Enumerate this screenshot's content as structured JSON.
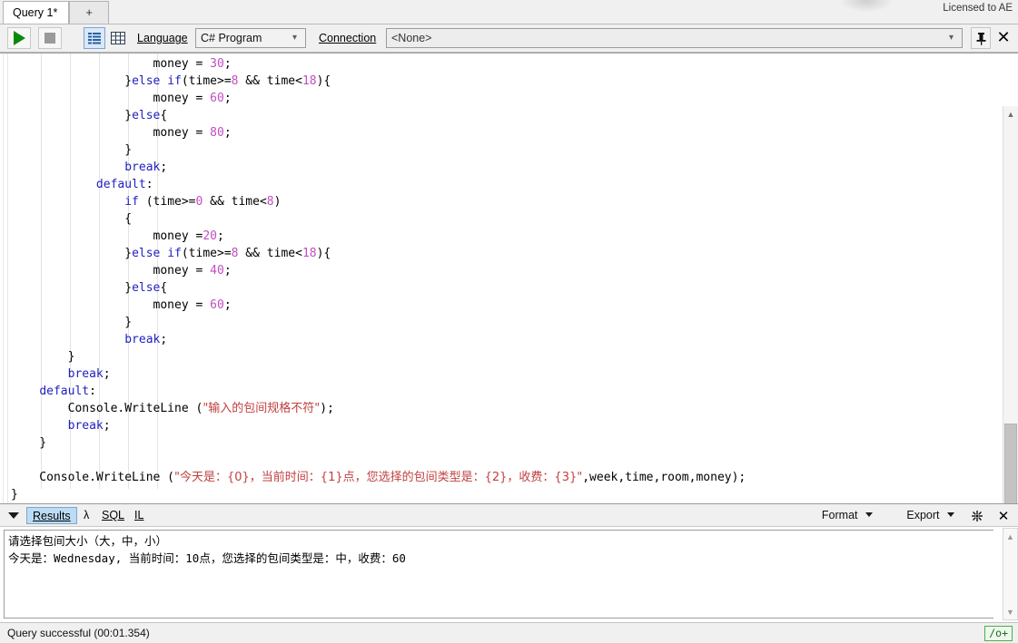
{
  "window": {
    "license": "Licensed to AE"
  },
  "tabs": {
    "items": [
      {
        "label": "Query 1*",
        "active": true
      },
      {
        "label": "+",
        "active": false
      }
    ]
  },
  "toolbar": {
    "run_icon": "play-icon",
    "stop_icon": "stop-icon",
    "output_text_icon": "text-output-icon",
    "output_grid_icon": "grid-output-icon",
    "language_label": "Language",
    "language_value": "C# Program",
    "connection_label": "Connection",
    "connection_value": "<None>",
    "pin_icon": "pin-icon",
    "close_icon": "close-icon"
  },
  "editor": {
    "language": "csharp",
    "lines": [
      [
        {
          "t": "                    money = ",
          "c": ""
        },
        {
          "t": "30",
          "c": "num"
        },
        {
          "t": ";",
          "c": ""
        }
      ],
      [
        {
          "t": "                }",
          "c": ""
        },
        {
          "t": "else",
          "c": "kw"
        },
        {
          "t": " ",
          "c": ""
        },
        {
          "t": "if",
          "c": "kw"
        },
        {
          "t": "(time>=",
          "c": ""
        },
        {
          "t": "8",
          "c": "num"
        },
        {
          "t": " && time<",
          "c": ""
        },
        {
          "t": "18",
          "c": "num"
        },
        {
          "t": "){",
          "c": ""
        }
      ],
      [
        {
          "t": "                    money = ",
          "c": ""
        },
        {
          "t": "60",
          "c": "num"
        },
        {
          "t": ";",
          "c": ""
        }
      ],
      [
        {
          "t": "                }",
          "c": ""
        },
        {
          "t": "else",
          "c": "kw"
        },
        {
          "t": "{",
          "c": ""
        }
      ],
      [
        {
          "t": "                    money = ",
          "c": ""
        },
        {
          "t": "80",
          "c": "num"
        },
        {
          "t": ";",
          "c": ""
        }
      ],
      [
        {
          "t": "                }",
          "c": ""
        }
      ],
      [
        {
          "t": "                ",
          "c": ""
        },
        {
          "t": "break",
          "c": "kw"
        },
        {
          "t": ";",
          "c": ""
        }
      ],
      [
        {
          "t": "            ",
          "c": ""
        },
        {
          "t": "default",
          "c": "kw"
        },
        {
          "t": ":",
          "c": ""
        }
      ],
      [
        {
          "t": "                ",
          "c": ""
        },
        {
          "t": "if",
          "c": "kw"
        },
        {
          "t": " (time>=",
          "c": ""
        },
        {
          "t": "0",
          "c": "num"
        },
        {
          "t": " && time<",
          "c": ""
        },
        {
          "t": "8",
          "c": "num"
        },
        {
          "t": ")",
          "c": ""
        }
      ],
      [
        {
          "t": "                {",
          "c": ""
        }
      ],
      [
        {
          "t": "                    money =",
          "c": ""
        },
        {
          "t": "20",
          "c": "num"
        },
        {
          "t": ";",
          "c": ""
        }
      ],
      [
        {
          "t": "                }",
          "c": ""
        },
        {
          "t": "else",
          "c": "kw"
        },
        {
          "t": " ",
          "c": ""
        },
        {
          "t": "if",
          "c": "kw"
        },
        {
          "t": "(time>=",
          "c": ""
        },
        {
          "t": "8",
          "c": "num"
        },
        {
          "t": " && time<",
          "c": ""
        },
        {
          "t": "18",
          "c": "num"
        },
        {
          "t": "){",
          "c": ""
        }
      ],
      [
        {
          "t": "                    money = ",
          "c": ""
        },
        {
          "t": "40",
          "c": "num"
        },
        {
          "t": ";",
          "c": ""
        }
      ],
      [
        {
          "t": "                }",
          "c": ""
        },
        {
          "t": "else",
          "c": "kw"
        },
        {
          "t": "{",
          "c": ""
        }
      ],
      [
        {
          "t": "                    money = ",
          "c": ""
        },
        {
          "t": "60",
          "c": "num"
        },
        {
          "t": ";",
          "c": ""
        }
      ],
      [
        {
          "t": "                }",
          "c": ""
        }
      ],
      [
        {
          "t": "                ",
          "c": ""
        },
        {
          "t": "break",
          "c": "kw"
        },
        {
          "t": ";",
          "c": ""
        }
      ],
      [
        {
          "t": "        }",
          "c": ""
        }
      ],
      [
        {
          "t": "        ",
          "c": ""
        },
        {
          "t": "break",
          "c": "kw"
        },
        {
          "t": ";",
          "c": ""
        }
      ],
      [
        {
          "t": "    ",
          "c": ""
        },
        {
          "t": "default",
          "c": "kw"
        },
        {
          "t": ":",
          "c": ""
        }
      ],
      [
        {
          "t": "        Console.WriteLine (",
          "c": ""
        },
        {
          "t": "\"输入的包间规格不符\"",
          "c": "str"
        },
        {
          "t": ");",
          "c": ""
        }
      ],
      [
        {
          "t": "        ",
          "c": ""
        },
        {
          "t": "break",
          "c": "kw"
        },
        {
          "t": ";",
          "c": ""
        }
      ],
      [
        {
          "t": "    }",
          "c": ""
        }
      ],
      [
        {
          "t": "",
          "c": ""
        }
      ],
      [
        {
          "t": "    Console.WriteLine (",
          "c": ""
        },
        {
          "t": "\"今天是：{0}，当前时间：{1}点，您选择的包间类型是：{2}，收费：{3}\"",
          "c": "str"
        },
        {
          "t": ",week,time,room,money);",
          "c": ""
        }
      ],
      [
        {
          "t": "}",
          "c": ""
        }
      ]
    ]
  },
  "results": {
    "collapse_icon": "triangle-down-icon",
    "tabs": [
      {
        "label": "Results",
        "selected": true
      },
      {
        "label": "λ",
        "selected": false
      },
      {
        "label": "SQL",
        "selected": false
      },
      {
        "label": "IL",
        "selected": false
      }
    ],
    "format_label": "Format",
    "export_label": "Export",
    "clear_icon": "burst-clear-icon",
    "close_icon": "close-icon",
    "output_lines": [
      "请选择包间大小（大，中，小）",
      "今天是：Wednesday, 当前时间：10点，您选择的包间类型是：中，收费：60"
    ]
  },
  "status": {
    "message": "Query successful  (00:01.354)",
    "optimization_badge": "/o+"
  },
  "colors": {
    "keyword": "#1f1fbf",
    "number": "#c14ec1",
    "string": "#c14040",
    "accent_selection": "#bcdcf5",
    "run_green": "#0a8a0a",
    "badge_green": "#4cae4c"
  }
}
